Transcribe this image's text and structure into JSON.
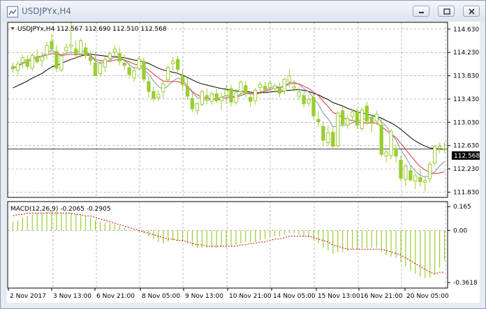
{
  "window": {
    "title": "USDJPYx,H4",
    "minimize": "minimize",
    "restore": "restore",
    "close": "close"
  },
  "main": {
    "header": "USDJPYx,H4  112.567 112.690 112.510 112.568",
    "price_ticks": [
      "114.630",
      "114.230",
      "113.830",
      "113.430",
      "113.030",
      "112.630",
      "112.230",
      "111.830"
    ],
    "price_tag": "112.568",
    "colors": {
      "bull": "#9acd32",
      "bear": "#9acd32",
      "ma_fast": "#e03030",
      "ma_mid": "#7d8fa8",
      "ma_slow": "#000000",
      "grid": "#8c8c8c"
    }
  },
  "macd": {
    "header": "MACD(12,26,9) -0.2065 -0.2905",
    "ticks": [
      "0.165",
      "0.00",
      "-0.3618"
    ],
    "colors": {
      "hist": "#9acd32",
      "signal": "#d00000"
    }
  },
  "time_axis": [
    "2 Nov 2017",
    "3 Nov 13:00",
    "6 Nov 21:00",
    "8 Nov 05:00",
    "9 Nov 13:00",
    "10 Nov 21:00",
    "14 Nov 05:00",
    "15 Nov 13:00",
    "16 Nov 21:00",
    "20 Nov 05:00"
  ],
  "chart_data": {
    "type": "candlestick",
    "title": "USDJPYx,H4",
    "y_range": [
      111.74,
      114.76
    ],
    "macd_range": [
      -0.4,
      0.2
    ],
    "ohlc": [
      [
        113.99,
        114.06,
        113.88,
        113.95
      ],
      [
        113.92,
        114.09,
        113.85,
        114.03
      ],
      [
        114.06,
        114.19,
        113.96,
        114.14
      ],
      [
        114.11,
        114.18,
        113.95,
        113.99
      ],
      [
        113.96,
        114.22,
        113.91,
        114.18
      ],
      [
        114.15,
        114.28,
        114.04,
        114.07
      ],
      [
        114.09,
        114.23,
        113.98,
        114.16
      ],
      [
        114.19,
        114.41,
        114.11,
        114.35
      ],
      [
        114.42,
        114.55,
        114.24,
        114.29
      ],
      [
        114.25,
        114.36,
        113.89,
        113.96
      ],
      [
        113.93,
        114.2,
        113.9,
        114.17
      ],
      [
        114.26,
        114.38,
        114.18,
        114.32
      ],
      [
        114.33,
        114.87,
        114.27,
        114.36
      ],
      [
        114.29,
        114.44,
        114.13,
        114.2
      ],
      [
        114.21,
        114.47,
        114.14,
        114.43
      ],
      [
        114.31,
        114.4,
        114.13,
        114.19
      ],
      [
        114.15,
        114.25,
        114.01,
        114.09
      ],
      [
        114.05,
        114.24,
        113.88,
        113.83
      ],
      [
        113.87,
        114.08,
        113.82,
        114.04
      ],
      [
        113.98,
        114.16,
        113.89,
        114.11
      ],
      [
        114.13,
        114.25,
        114.06,
        114.21
      ],
      [
        114.24,
        114.36,
        114.13,
        114.29
      ],
      [
        114.21,
        114.32,
        114.01,
        114.08
      ],
      [
        114.05,
        114.2,
        113.93,
        114.01
      ],
      [
        113.97,
        114.09,
        113.78,
        113.85
      ],
      [
        113.79,
        113.98,
        113.73,
        113.92
      ],
      [
        113.95,
        114.16,
        113.92,
        114.12
      ],
      [
        114.08,
        114.15,
        113.72,
        113.77
      ],
      [
        113.73,
        113.82,
        113.45,
        113.56
      ],
      [
        113.56,
        113.65,
        113.38,
        113.44
      ],
      [
        113.45,
        113.58,
        113.39,
        113.51
      ],
      [
        113.55,
        113.74,
        113.44,
        113.69
      ],
      [
        113.76,
        114.01,
        113.7,
        113.97
      ],
      [
        114.04,
        114.15,
        113.92,
        114.08
      ],
      [
        114.11,
        114.17,
        113.88,
        113.94
      ],
      [
        113.82,
        113.93,
        113.59,
        113.68
      ],
      [
        113.65,
        113.79,
        113.42,
        113.48
      ],
      [
        113.44,
        113.53,
        113.21,
        113.26
      ],
      [
        113.23,
        113.38,
        113.16,
        113.35
      ],
      [
        113.34,
        113.58,
        113.31,
        113.56
      ],
      [
        113.49,
        113.61,
        113.34,
        113.44
      ],
      [
        113.39,
        113.56,
        113.33,
        113.52
      ],
      [
        113.52,
        113.61,
        113.36,
        113.4
      ],
      [
        113.4,
        113.54,
        113.25,
        113.46
      ],
      [
        113.49,
        113.67,
        113.35,
        113.58
      ],
      [
        113.61,
        113.68,
        113.3,
        113.38
      ],
      [
        113.37,
        113.6,
        113.33,
        113.54
      ],
      [
        113.56,
        113.75,
        113.49,
        113.72
      ],
      [
        113.66,
        113.74,
        113.45,
        113.52
      ],
      [
        113.46,
        113.56,
        113.3,
        113.39
      ],
      [
        113.4,
        113.62,
        113.33,
        113.58
      ],
      [
        113.63,
        113.73,
        113.55,
        113.68
      ],
      [
        113.65,
        113.73,
        113.52,
        113.6
      ],
      [
        113.63,
        113.75,
        113.57,
        113.7
      ],
      [
        113.61,
        113.7,
        113.54,
        113.66
      ],
      [
        113.62,
        113.72,
        113.46,
        113.53
      ],
      [
        113.57,
        113.79,
        113.51,
        113.77
      ],
      [
        113.73,
        113.94,
        113.63,
        113.83
      ],
      [
        113.62,
        113.76,
        113.55,
        113.64
      ],
      [
        113.48,
        113.64,
        113.41,
        113.55
      ],
      [
        113.49,
        113.57,
        113.28,
        113.35
      ],
      [
        113.36,
        113.51,
        113.29,
        113.42
      ],
      [
        113.46,
        113.55,
        113.09,
        113.14
      ],
      [
        113.08,
        113.22,
        112.95,
        113.04
      ],
      [
        112.96,
        113.04,
        112.63,
        112.72
      ],
      [
        112.68,
        112.98,
        112.63,
        112.85
      ],
      [
        112.86,
        112.93,
        112.56,
        112.62
      ],
      [
        112.63,
        113.22,
        112.6,
        113.19
      ],
      [
        113.23,
        113.31,
        112.94,
        113.0
      ],
      [
        112.98,
        113.16,
        112.92,
        113.1
      ],
      [
        113.13,
        113.26,
        113.06,
        113.21
      ],
      [
        113.21,
        113.27,
        112.92,
        112.98
      ],
      [
        112.92,
        113.28,
        112.88,
        113.24
      ],
      [
        113.31,
        113.38,
        112.98,
        113.05
      ],
      [
        113.11,
        113.17,
        112.86,
        113.03
      ],
      [
        113.05,
        113.23,
        112.98,
        113.17
      ],
      [
        112.98,
        113.08,
        112.44,
        112.48
      ],
      [
        112.45,
        112.55,
        112.34,
        112.52
      ],
      [
        112.46,
        112.92,
        112.4,
        112.87
      ],
      [
        112.58,
        112.66,
        112.34,
        112.45
      ],
      [
        112.38,
        112.47,
        112.02,
        112.07
      ],
      [
        112.05,
        112.32,
        111.93,
        112.28
      ],
      [
        112.2,
        112.29,
        112.01,
        112.04
      ],
      [
        112.02,
        112.16,
        111.88,
        112.11
      ],
      [
        112.08,
        112.22,
        111.92,
        112.01
      ],
      [
        112.0,
        112.09,
        111.84,
        112.03
      ],
      [
        112.06,
        112.35,
        112.0,
        112.31
      ],
      [
        112.33,
        112.64,
        112.29,
        112.61
      ],
      [
        112.58,
        112.68,
        112.5,
        112.62
      ],
      [
        112.57,
        112.69,
        112.51,
        112.57
      ]
    ],
    "ma_fast": [
      113.97,
      113.99,
      114.04,
      114.07,
      114.11,
      114.14,
      114.16,
      114.19,
      114.21,
      114.2,
      114.18,
      114.19,
      114.2,
      114.19,
      114.2,
      114.19,
      114.17,
      114.11,
      114.09,
      114.08,
      114.08,
      114.1,
      114.11,
      114.1,
      114.07,
      114.03,
      114.01,
      113.98,
      113.93,
      113.86,
      113.79,
      113.74,
      113.73,
      113.73,
      113.73,
      113.7,
      113.64,
      113.56,
      113.5,
      113.46,
      113.44,
      113.43,
      113.42,
      113.43,
      113.45,
      113.46,
      113.46,
      113.49,
      113.52,
      113.52,
      113.51,
      113.53,
      113.56,
      113.59,
      113.62,
      113.63,
      113.65,
      113.69,
      113.7,
      113.69,
      113.65,
      113.61,
      113.55,
      113.49,
      113.39,
      113.3,
      113.2,
      113.16,
      113.11,
      113.08,
      113.06,
      113.04,
      113.02,
      113.02,
      113.02,
      113.02,
      112.96,
      112.89,
      112.83,
      112.77,
      112.67,
      112.56,
      112.46,
      112.36,
      112.27,
      112.21,
      112.17,
      112.15,
      112.16,
      112.18
    ],
    "ma_mid": [
      113.95,
      114.0,
      114.07,
      114.1,
      114.14,
      114.16,
      114.17,
      114.23,
      114.27,
      114.22,
      114.19,
      114.22,
      114.24,
      114.22,
      114.26,
      114.24,
      114.19,
      114.08,
      114.05,
      114.06,
      114.1,
      114.15,
      114.14,
      114.1,
      114.02,
      113.96,
      113.98,
      113.94,
      113.86,
      113.74,
      113.65,
      113.59,
      113.66,
      113.74,
      113.79,
      113.76,
      113.66,
      113.54,
      113.46,
      113.42,
      113.41,
      113.42,
      113.44,
      113.46,
      113.49,
      113.47,
      113.47,
      113.52,
      113.55,
      113.53,
      113.51,
      113.55,
      113.58,
      113.62,
      113.65,
      113.63,
      113.65,
      113.71,
      113.72,
      113.68,
      113.61,
      113.55,
      113.45,
      113.34,
      113.19,
      113.09,
      112.95,
      112.97,
      112.98,
      112.99,
      113.02,
      113.05,
      113.08,
      113.1,
      113.12,
      113.13,
      113.04,
      112.96,
      112.84,
      112.73,
      112.56,
      112.43,
      112.29,
      112.19,
      112.12,
      112.09,
      112.12,
      112.18,
      112.28,
      112.36
    ],
    "ma_slow": [
      113.62,
      113.66,
      113.7,
      113.74,
      113.79,
      113.83,
      113.87,
      113.93,
      113.98,
      114.01,
      114.04,
      114.08,
      114.11,
      114.14,
      114.17,
      114.19,
      114.2,
      114.19,
      114.18,
      114.17,
      114.16,
      114.16,
      114.15,
      114.14,
      114.12,
      114.1,
      114.09,
      114.07,
      114.04,
      114.0,
      113.96,
      113.93,
      113.91,
      113.89,
      113.87,
      113.84,
      113.8,
      113.76,
      113.72,
      113.69,
      113.67,
      113.65,
      113.63,
      113.61,
      113.6,
      113.58,
      113.57,
      113.56,
      113.56,
      113.55,
      113.54,
      113.54,
      113.54,
      113.55,
      113.56,
      113.56,
      113.57,
      113.58,
      113.59,
      113.59,
      113.58,
      113.56,
      113.53,
      113.5,
      113.46,
      113.42,
      113.37,
      113.34,
      113.31,
      113.27,
      113.24,
      113.21,
      113.19,
      113.17,
      113.15,
      113.13,
      113.1,
      113.06,
      113.02,
      112.97,
      112.91,
      112.84,
      112.77,
      112.71,
      112.66,
      112.62,
      112.59,
      112.58,
      112.57,
      112.57
    ],
    "macd_hist": [
      0.06,
      0.07,
      0.09,
      0.1,
      0.11,
      0.12,
      0.12,
      0.13,
      0.14,
      0.13,
      0.12,
      0.12,
      0.12,
      0.11,
      0.11,
      0.1,
      0.09,
      0.07,
      0.06,
      0.05,
      0.05,
      0.04,
      0.03,
      0.02,
      0.01,
      0.0,
      -0.01,
      -0.02,
      -0.04,
      -0.06,
      -0.08,
      -0.09,
      -0.08,
      -0.07,
      -0.07,
      -0.08,
      -0.09,
      -0.11,
      -0.12,
      -0.12,
      -0.12,
      -0.12,
      -0.12,
      -0.11,
      -0.11,
      -0.11,
      -0.1,
      -0.09,
      -0.08,
      -0.08,
      -0.08,
      -0.07,
      -0.06,
      -0.05,
      -0.04,
      -0.04,
      -0.03,
      -0.02,
      -0.02,
      -0.03,
      -0.04,
      -0.05,
      -0.07,
      -0.09,
      -0.12,
      -0.14,
      -0.16,
      -0.15,
      -0.15,
      -0.14,
      -0.13,
      -0.13,
      -0.12,
      -0.12,
      -0.12,
      -0.12,
      -0.15,
      -0.17,
      -0.18,
      -0.19,
      -0.22,
      -0.25,
      -0.28,
      -0.3,
      -0.32,
      -0.33,
      -0.33,
      -0.31,
      -0.26,
      -0.21
    ],
    "macd_signal": [
      0.1,
      0.11,
      0.11,
      0.12,
      0.12,
      0.12,
      0.12,
      0.12,
      0.12,
      0.12,
      0.12,
      0.12,
      0.12,
      0.11,
      0.11,
      0.1,
      0.1,
      0.09,
      0.08,
      0.07,
      0.06,
      0.05,
      0.04,
      0.03,
      0.02,
      0.01,
      0.0,
      -0.01,
      -0.02,
      -0.03,
      -0.04,
      -0.05,
      -0.06,
      -0.06,
      -0.07,
      -0.07,
      -0.08,
      -0.09,
      -0.1,
      -0.1,
      -0.11,
      -0.11,
      -0.11,
      -0.11,
      -0.11,
      -0.11,
      -0.11,
      -0.1,
      -0.1,
      -0.09,
      -0.09,
      -0.08,
      -0.08,
      -0.07,
      -0.06,
      -0.06,
      -0.05,
      -0.04,
      -0.04,
      -0.04,
      -0.04,
      -0.04,
      -0.05,
      -0.06,
      -0.07,
      -0.08,
      -0.1,
      -0.11,
      -0.12,
      -0.13,
      -0.13,
      -0.13,
      -0.13,
      -0.13,
      -0.13,
      -0.13,
      -0.13,
      -0.14,
      -0.15,
      -0.16,
      -0.17,
      -0.19,
      -0.21,
      -0.23,
      -0.25,
      -0.27,
      -0.29,
      -0.3,
      -0.29,
      -0.29
    ]
  }
}
